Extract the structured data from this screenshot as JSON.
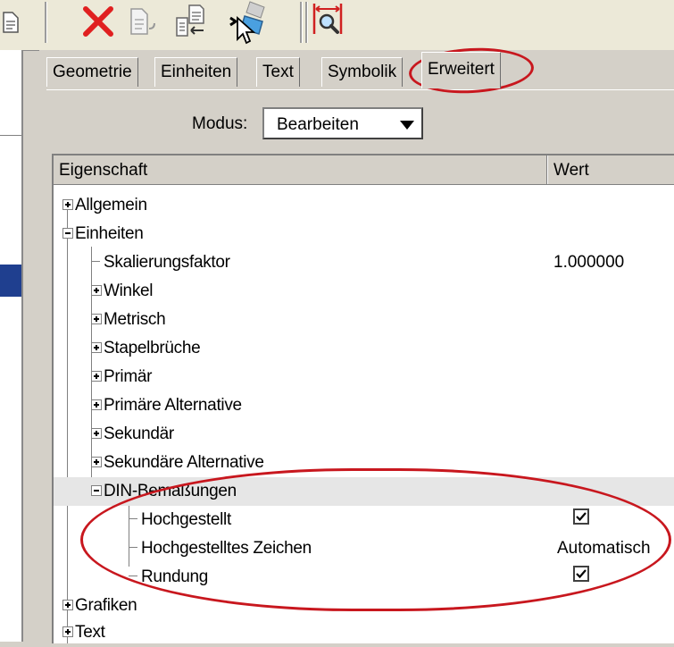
{
  "toolbar": {
    "buttons": [
      {
        "name": "delete-icon"
      },
      {
        "name": "copy-document-icon"
      },
      {
        "name": "insert-document-icon"
      },
      {
        "name": "eraser-icon"
      },
      {
        "name": "zoom-dimension-icon"
      }
    ]
  },
  "tabs": [
    {
      "label": "Geometrie"
    },
    {
      "label": "Einheiten"
    },
    {
      "label": "Text"
    },
    {
      "label": "Symbolik"
    },
    {
      "label": "Erweitert"
    }
  ],
  "modus": {
    "label": "Modus:",
    "value": "Bearbeiten"
  },
  "grid": {
    "col_property": "Eigenschaft",
    "col_value": "Wert",
    "rows": [
      {
        "label": "Allgemein",
        "value": ""
      },
      {
        "label": "Einheiten",
        "value": ""
      },
      {
        "label": "Skalierungsfaktor",
        "value": "1.000000"
      },
      {
        "label": "Winkel",
        "value": ""
      },
      {
        "label": "Metrisch",
        "value": ""
      },
      {
        "label": "Stapelbrüche",
        "value": ""
      },
      {
        "label": "Primär",
        "value": ""
      },
      {
        "label": "Primäre Alternative",
        "value": ""
      },
      {
        "label": "Sekundär",
        "value": ""
      },
      {
        "label": "Sekundäre Alternative",
        "value": ""
      },
      {
        "label": "DIN-Bemaßungen",
        "value": ""
      },
      {
        "label": "Hochgestellt",
        "value": "",
        "checked": true
      },
      {
        "label": "Hochgestelltes Zeichen",
        "value": "Automatisch"
      },
      {
        "label": "Rundung",
        "value": "",
        "checked": true
      },
      {
        "label": "Grafiken",
        "value": ""
      },
      {
        "label": "Text",
        "value": ""
      }
    ]
  },
  "colors": {
    "annotation": "#c8171e",
    "delete_icon": "#e02020"
  }
}
